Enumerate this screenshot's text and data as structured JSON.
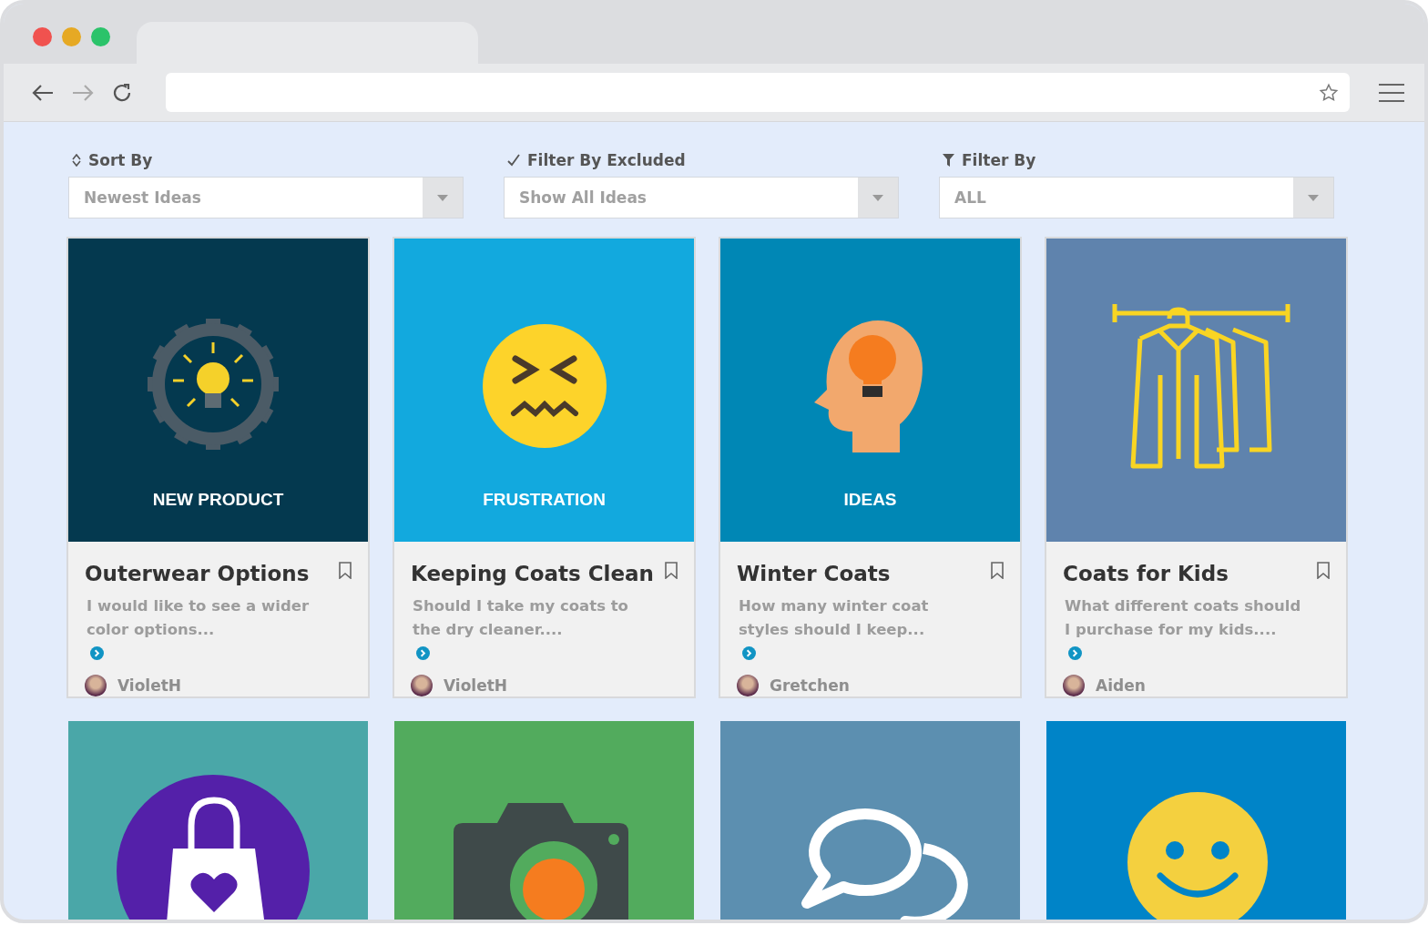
{
  "filters": [
    {
      "kind": "sort",
      "label": "Sort By",
      "value": "Newest Ideas"
    },
    {
      "kind": "check",
      "label": "Filter By Excluded",
      "value": "Show All Ideas"
    },
    {
      "kind": "funnel",
      "label": "Filter By",
      "value": "ALL"
    }
  ],
  "ideas": [
    {
      "kind": "gear-bulb",
      "color": "#04394f",
      "label": "NEW PRODUCT",
      "title": "Outerwear Options",
      "excerpt": "I would like to see a wider color options...",
      "author": "VioletH"
    },
    {
      "kind": "frustrated-face",
      "color": "#12a9de",
      "label": "FRUSTRATION",
      "title": "Keeping Coats Clean",
      "excerpt": "Should I take my coats to the dry cleaner....",
      "author": "VioletH"
    },
    {
      "kind": "head-bulb",
      "color": "#0087b5",
      "label": "IDEAS",
      "title": "Winter Coats",
      "excerpt": "How many winter coat styles should I keep...",
      "author": "Gretchen"
    },
    {
      "kind": "coats",
      "color": "#5f83ad",
      "title": "Coats for Kids",
      "excerpt": "What different coats should I purchase for my kids....",
      "author": "Aiden"
    },
    {
      "kind": "bag",
      "color": "#4aa7a8"
    },
    {
      "kind": "camera",
      "color": "#52ab5d"
    },
    {
      "kind": "speech",
      "color": "#5c8fb0"
    },
    {
      "kind": "smiley",
      "color": "#0084c8"
    }
  ]
}
